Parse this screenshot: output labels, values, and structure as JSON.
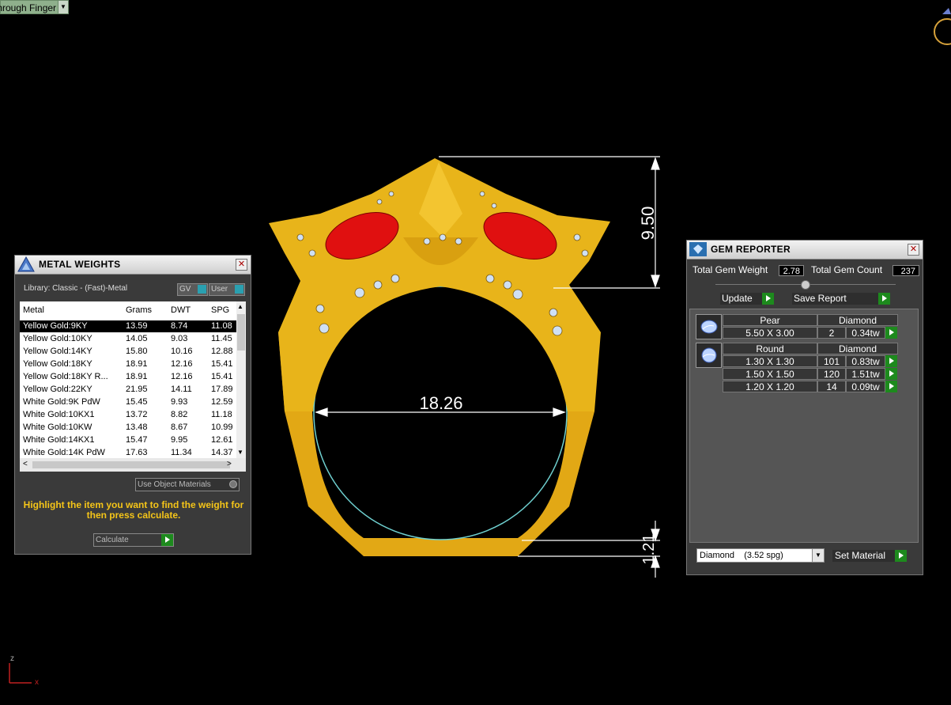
{
  "viewport": {
    "view_dropdown": "Through Finger",
    "axis_z": "z",
    "axis_x": "x",
    "dim_top": "9.50",
    "dim_inner": "18.26",
    "dim_bottom": "1.21"
  },
  "metal_weights": {
    "title": "METAL WEIGHTS",
    "library": "Library: Classic - (Fast)-Metal",
    "toggle_gv": "GV",
    "toggle_user": "User",
    "columns": [
      "Metal",
      "Grams",
      "DWT",
      "SPG"
    ],
    "rows": [
      [
        "Yellow Gold:9KY",
        "13.59",
        "8.74",
        "11.08"
      ],
      [
        "Yellow Gold:10KY",
        "14.05",
        "9.03",
        "11.45"
      ],
      [
        "Yellow Gold:14KY",
        "15.80",
        "10.16",
        "12.88"
      ],
      [
        "Yellow Gold:18KY",
        "18.91",
        "12.16",
        "15.41"
      ],
      [
        "Yellow Gold:18KY R...",
        "18.91",
        "12.16",
        "15.41"
      ],
      [
        "Yellow Gold:22KY",
        "21.95",
        "14.11",
        "17.89"
      ],
      [
        "White Gold:9K PdW",
        "15.45",
        "9.93",
        "12.59"
      ],
      [
        "White Gold:10KX1",
        "13.72",
        "8.82",
        "11.18"
      ],
      [
        "White Gold:10KW",
        "13.48",
        "8.67",
        "10.99"
      ],
      [
        "White Gold:14KX1",
        "15.47",
        "9.95",
        "12.61"
      ],
      [
        "White Gold:14K PdW",
        "17.63",
        "11.34",
        "14.37"
      ]
    ],
    "use_object_materials": "Use Object Materials",
    "hint": "Highlight the item you want to find the weight for then press calculate.",
    "calculate": "Calculate"
  },
  "gem_reporter": {
    "title": "GEM REPORTER",
    "total_weight_label": "Total Gem Weight",
    "total_weight": "2.78",
    "total_count_label": "Total Gem Count",
    "total_count": "237",
    "update": "Update",
    "save_report": "Save Report",
    "groups": [
      {
        "shape": "Pear",
        "material": "Diamond",
        "rows": [
          [
            "5.50 X 3.00",
            "2",
            "0.34tw"
          ]
        ]
      },
      {
        "shape": "Round",
        "material": "Diamond",
        "rows": [
          [
            "1.30 X 1.30",
            "101",
            "0.83tw"
          ],
          [
            "1.50 X 1.50",
            "120",
            "1.51tw"
          ],
          [
            "1.20 X 1.20",
            "14",
            "0.09tw"
          ]
        ]
      }
    ],
    "material_select": "Diamond    (3.52 spg)",
    "set_material": "Set Material"
  },
  "colors": {
    "gold": "#e8b41a",
    "ruby": "#e01010",
    "go_green": "#1d8a1d",
    "hint_yellow": "#f5c518"
  }
}
